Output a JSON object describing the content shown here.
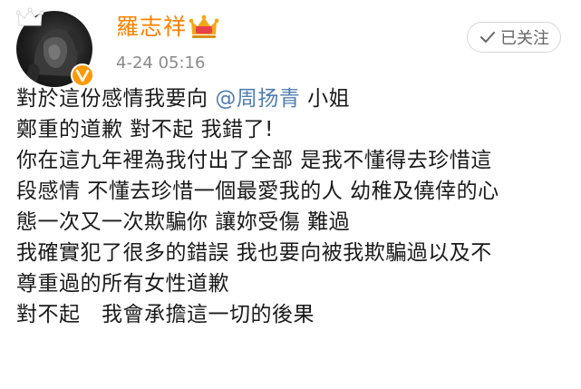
{
  "user": {
    "name": "羅志祥",
    "timestamp": "4-24 05:16"
  },
  "follow_button": {
    "label": "已关注"
  },
  "post": {
    "line1_before": "對於這份感情我要向",
    "mention": "@周扬青",
    "line1_after": "小姐",
    "line2": "鄭重的道歉 對不起 我錯了!",
    "line3": "你在這九年裡為我付出了全部 是我不懂得去珍惜這",
    "line4": "段感情 不懂去珍惜一個最愛我的人 幼稚及僥倖的心",
    "line5": "態一次又一次欺騙你 讓妳受傷 難過",
    "line6": "我確實犯了很多的錯誤 我也要向被我欺騙過以及不",
    "line7": "尊重過的所有女性道歉",
    "line8": "對不起　我會承擔這一切的後果"
  },
  "colors": {
    "username": "#ff8200",
    "mention": "#507daf",
    "text": "#1a1a1a",
    "timestamp": "#8a8a8a",
    "verified": "#ff9a00"
  },
  "icons": {
    "avatar": "lion-avatar",
    "crown": "crown-icon",
    "verified": "verified-v-icon",
    "vip": "vip-crown-icon",
    "follow": "check-icon"
  }
}
